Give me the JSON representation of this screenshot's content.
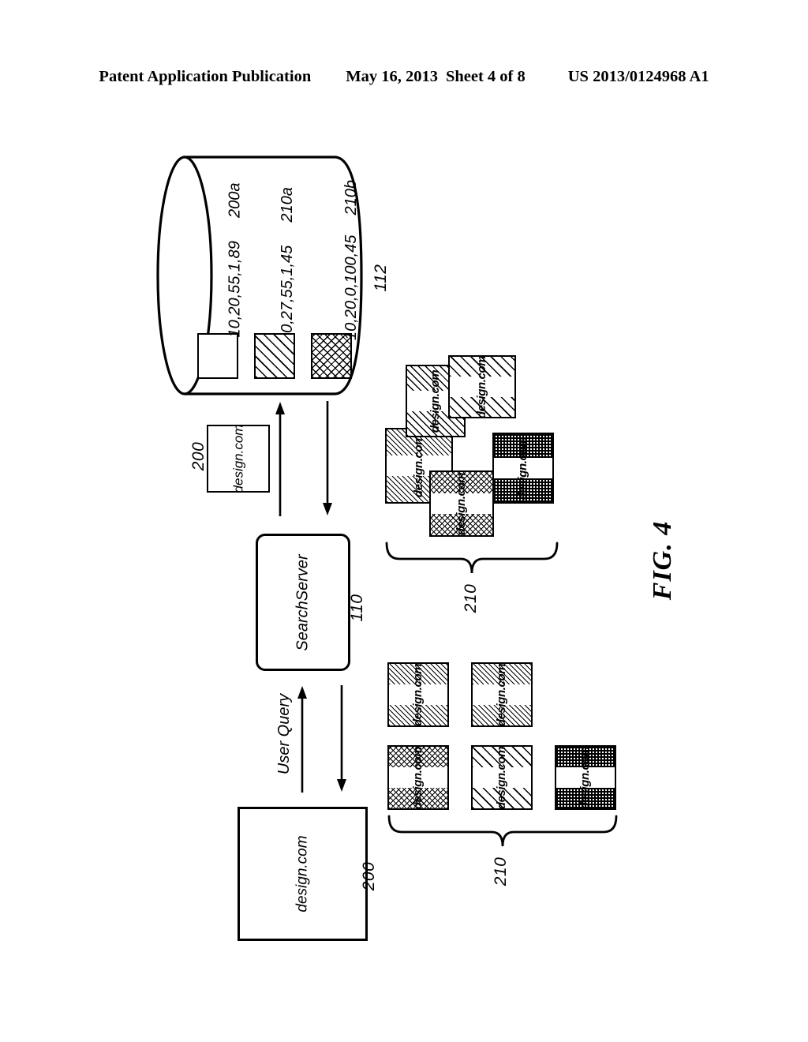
{
  "header": {
    "publication": "Patent Application Publication",
    "date": "May 16, 2013",
    "sheet": "Sheet 4 of 8",
    "number": "US 2013/0124968 A1"
  },
  "figure": {
    "caption": "FIG. 4",
    "database": {
      "ref": "112",
      "records": [
        {
          "values": "10,20,55,1,89",
          "ref": "200a",
          "pattern": "plain"
        },
        {
          "values": "0,27,55,1,45",
          "ref": "210a",
          "pattern": "diagonal-hatch"
        },
        {
          "values": "10,20,0,100,45",
          "ref": "210b",
          "pattern": "cross-hatch"
        }
      ]
    },
    "search_server": {
      "label": "SearchServer",
      "ref": "110"
    },
    "query_arrow_label": "User Query",
    "uploaded_image": {
      "label": "design.com",
      "ref": "200"
    },
    "source_image": {
      "label": "design.com",
      "ref": "200"
    },
    "results_top": {
      "ref": "210",
      "tiles": [
        {
          "label": "design.com",
          "pattern": "diagonal-hatch-medium"
        },
        {
          "label": "design.com",
          "pattern": "diagonal-hatch-wide"
        },
        {
          "label": "design.com",
          "pattern": "diagonal-hatch-fine"
        },
        {
          "label": "design.com",
          "pattern": "checker-dark"
        },
        {
          "label": "design.com",
          "pattern": "cross-hatch"
        }
      ]
    },
    "results_bottom": {
      "ref": "210",
      "tiles": [
        {
          "label": "design.com",
          "pattern": "diagonal-hatch-fine"
        },
        {
          "label": "design.com",
          "pattern": "diagonal-hatch-fine"
        },
        {
          "label": "design.com",
          "pattern": "cross-hatch"
        },
        {
          "label": "design.com",
          "pattern": "diagonal-hatch-wide"
        },
        {
          "label": "design.com",
          "pattern": "checker-dark"
        }
      ]
    }
  }
}
